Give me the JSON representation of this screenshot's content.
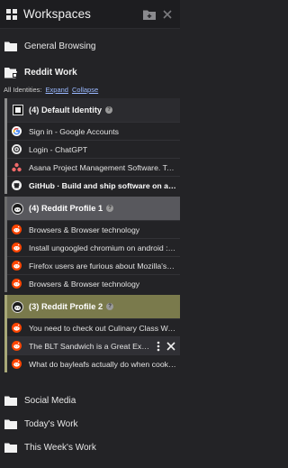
{
  "header": {
    "title": "Workspaces",
    "new_folder_icon": "folder-plus-icon",
    "close_icon": "close-icon"
  },
  "folders_top": [
    {
      "label": "General Browsing",
      "icon": "folder-icon"
    }
  ],
  "expanded_folder": {
    "label": "Reddit Work",
    "identities_label": "All Identities:",
    "expand_label": "Expand",
    "collapse_label": "Collapse"
  },
  "groups": [
    {
      "name": "(4) Default Identity",
      "help": "?",
      "tabs": [
        {
          "label": "Sign in - Google Accounts",
          "icon": "google-icon"
        },
        {
          "label": "Login - ChatGPT",
          "icon": "openai-icon"
        },
        {
          "label": "Asana Project Management Software. Tea...",
          "icon": "asana-icon"
        },
        {
          "label": "GitHub · Build and ship software on a si...",
          "icon": "github-icon",
          "active": true
        }
      ]
    },
    {
      "name": "(4) Reddit Profile 1",
      "help": "?",
      "tabs": [
        {
          "label": "Browsers & Browser technology",
          "icon": "reddit-icon"
        },
        {
          "label": "Install ungoogled chromium on android : r...",
          "icon": "reddit-icon"
        },
        {
          "label": "Firefox users are furious about Mozilla's ne...",
          "icon": "reddit-icon"
        },
        {
          "label": "Browsers & Browser technology",
          "icon": "reddit-icon"
        }
      ]
    },
    {
      "name": "(3) Reddit Profile 2",
      "help": "?",
      "tabs": [
        {
          "label": "You need to check out Culinary Class War...",
          "icon": "reddit-icon"
        },
        {
          "label": "The BLT Sandwich is a Great Exam...",
          "icon": "reddit-icon",
          "hover": true
        },
        {
          "label": "What do bayleafs actually do when cookin...",
          "icon": "reddit-icon"
        }
      ]
    }
  ],
  "folders_bottom": [
    {
      "label": "Social Media",
      "icon": "folder-icon"
    },
    {
      "label": "Today's Work",
      "icon": "folder-icon"
    },
    {
      "label": "This Week's Work",
      "icon": "folder-icon"
    }
  ],
  "colors": {
    "background": "#232326",
    "default_identity_border": "#8b8b8b",
    "profile1_header": "#58585d",
    "profile2_header": "#7a7a4c",
    "link": "#9ab9ff",
    "reddit_orange": "#ff4500"
  }
}
